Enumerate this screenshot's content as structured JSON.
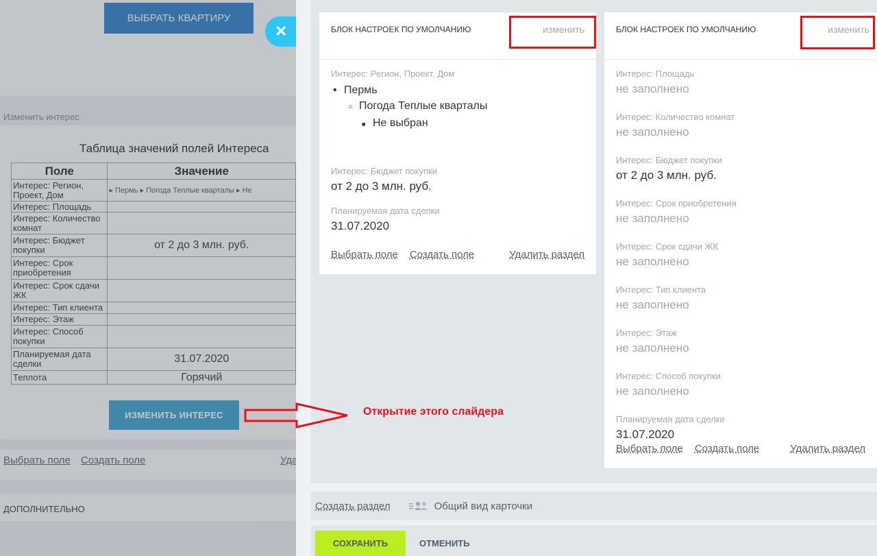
{
  "background": {
    "choose_apartment_button": "ВЫБРАТЬ КВАРТИРУ",
    "change_interest_link": "Изменить интерес",
    "table_title": "Таблица значений полей Интереса",
    "table_headers": [
      "Поле",
      "Значение"
    ],
    "table_rows": [
      {
        "field": "Интерес: Регион, Проект, Дом",
        "value": "▸ Пермь    ▸ Погода Теплые кварталы         ▸ Не"
      },
      {
        "field": "Интерес: Площадь",
        "value": ""
      },
      {
        "field": "Интерес: Количество комнат",
        "value": ""
      },
      {
        "field": "Интерес: Бюджет покупки",
        "value": "от 2 до 3 млн. руб."
      },
      {
        "field": "Интерес: Срок приобретения",
        "value": ""
      },
      {
        "field": "Интерес: Срок сдачи ЖК",
        "value": ""
      },
      {
        "field": "Интерес: Тип клиента",
        "value": ""
      },
      {
        "field": "Интерес: Этаж",
        "value": ""
      },
      {
        "field": "Интерес: Способ покупки",
        "value": ""
      },
      {
        "field": "Планируемая дата сделки",
        "value": "31.07.2020"
      },
      {
        "field": "Теплота",
        "value": "Горячий"
      }
    ],
    "change_interest_button": "ИЗМЕНИТЬ ИНТЕРЕС",
    "select_field_link": "Выбрать поле",
    "create_field_link": "Создать поле",
    "delete_link_partial": "Уда",
    "additional_section": "ДОПОЛНИТЕЛЬНО"
  },
  "close_icon": "✕",
  "card_left": {
    "title": "БЛОК НАСТРОЕК ПО УМОЛЧАНИЮ",
    "edit": "изменить",
    "region_label": "Интерес: Регион, Проект, Дом",
    "tree": {
      "level1": "Пермь",
      "level2": "Погода Теплые кварталы",
      "level3": "Не выбран"
    },
    "budget_label": "Интерес: Бюджет покупки",
    "budget_value": "от 2 до 3 млн. руб.",
    "date_label": "Планируемая дата сделки",
    "date_value": "31.07.2020",
    "footer": {
      "select_field": "Выбрать поле",
      "create_field": "Создать поле",
      "delete_section": "Удалить раздел"
    }
  },
  "card_right": {
    "title": "БЛОК НАСТРОЕК ПО УМОЛЧАНИЮ",
    "edit": "изменить",
    "fields": [
      {
        "label": "Интерес: Площадь",
        "value": "не заполнено",
        "empty": true
      },
      {
        "label": "Интерес: Количество комнат",
        "value": "не заполнено",
        "empty": true
      },
      {
        "label": "Интерес: Бюджет покупки",
        "value": "от 2 до 3 млн. руб.",
        "empty": false
      },
      {
        "label": "Интерес: Срок приобретения",
        "value": "не заполнено",
        "empty": true
      },
      {
        "label": "Интерес: Срок сдачи ЖК",
        "value": "не заполнено",
        "empty": true
      },
      {
        "label": "Интерес: Тип клиента",
        "value": "не заполнено",
        "empty": true
      },
      {
        "label": "Интерес: Этаж",
        "value": "не заполнено",
        "empty": true
      },
      {
        "label": "Интерес: Способ покупки",
        "value": "не заполнено",
        "empty": true
      },
      {
        "label": "Планируемая дата сделки",
        "value": "31.07.2020",
        "empty": false
      }
    ],
    "footer": {
      "select_field": "Выбрать поле",
      "create_field": "Создать поле",
      "delete_section": "Удалить раздел"
    }
  },
  "bottom_bar": {
    "create_section": "Создать раздел",
    "card_view": "Общий вид карточки"
  },
  "buttons": {
    "save": "СОХРАНИТЬ",
    "cancel": "ОТМЕНИТЬ"
  },
  "annotation": {
    "text": "Открытие этого слайдера"
  },
  "colors": {
    "accent_blue": "#2fc6f6",
    "save_green": "#bbed21",
    "annotation_red": "#e0161c"
  }
}
